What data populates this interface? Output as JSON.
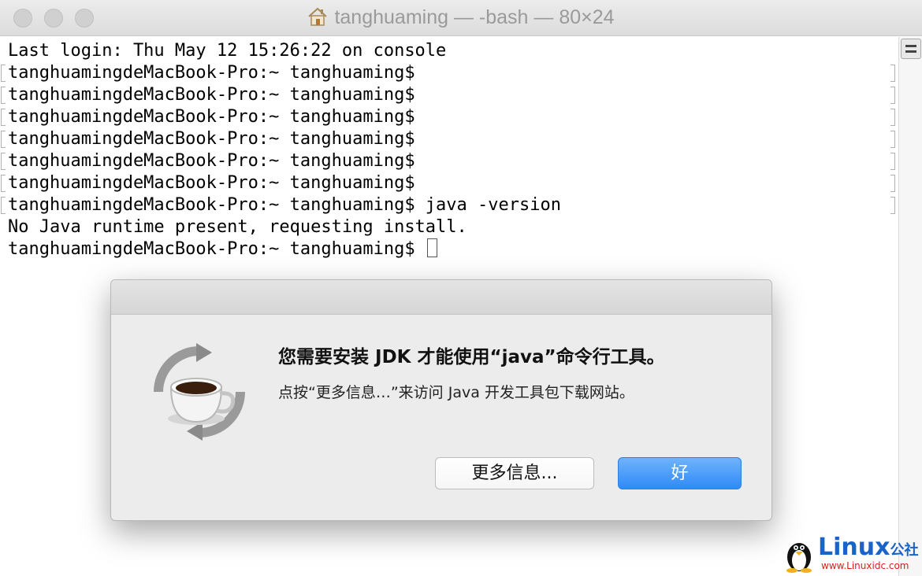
{
  "window": {
    "title": "tanghuaming — -bash — 80×24"
  },
  "terminal": {
    "lines": [
      "Last login: Thu May 12 15:26:22 on console",
      "tanghuamingdeMacBook-Pro:~ tanghuaming$",
      "tanghuamingdeMacBook-Pro:~ tanghuaming$",
      "tanghuamingdeMacBook-Pro:~ tanghuaming$",
      "tanghuamingdeMacBook-Pro:~ tanghuaming$",
      "tanghuamingdeMacBook-Pro:~ tanghuaming$",
      "tanghuamingdeMacBook-Pro:~ tanghuaming$",
      "tanghuamingdeMacBook-Pro:~ tanghuaming$ java -version",
      "No Java runtime present, requesting install.",
      "tanghuamingdeMacBook-Pro:~ tanghuaming$ "
    ]
  },
  "dialog": {
    "title": "您需要安装 JDK 才能使用“java”命令行工具。",
    "message": "点按“更多信息…”来访问 Java 开发工具包下载网站。",
    "more_info_label": "更多信息...",
    "ok_label": "好",
    "icon": "java-coffee-cup-icon"
  },
  "watermark": {
    "logo_text": "Linux",
    "logo_cn": "公社",
    "url": "www.Linuxidc.com"
  },
  "colors": {
    "ok_button": "#2f8af8",
    "watermark_blue": "#1a63c9",
    "watermark_red": "#e01a1a"
  }
}
